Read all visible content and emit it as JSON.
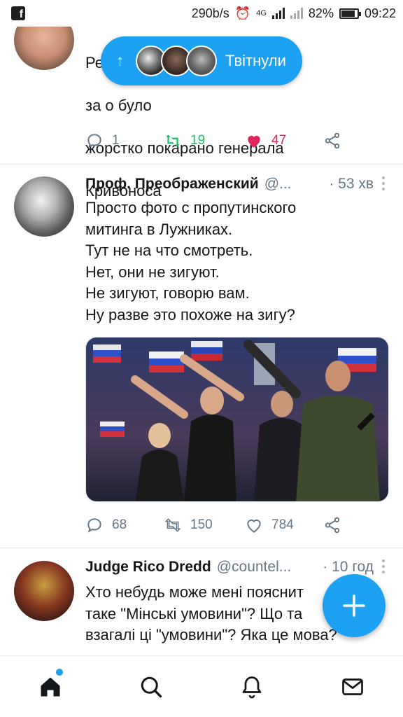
{
  "status_bar": {
    "speed": "290b/s",
    "network": "4G",
    "battery": "82%",
    "time": "09:22"
  },
  "pill": {
    "label": "Твітнули"
  },
  "tweets": [
    {
      "text_top_line": "Резі                          али",
      "text_line2": "за                                   о було",
      "text_line3": "жорстко покарано генерала",
      "text_line4": "Кривоноса",
      "replies": "1",
      "retweets": "19",
      "likes": "47"
    },
    {
      "name": "Проф. Преображенский",
      "handle": "@...",
      "time": "· 53 хв",
      "text": "Просто фото с пропутинского\nмитинга в Лужниках.\nТут не на что смотреть.\nНет, они не зигуют.\nНе зигуют, говорю вам.\nНу разве это похоже на зигу?",
      "replies": "68",
      "retweets": "150",
      "likes": "784"
    },
    {
      "name": "Judge Rico Dredd",
      "handle": "@countel...",
      "time": "· 10 год",
      "text": "Хто небудь може мені пояснит\nтаке \"Мінські умовини\"? Що та\nвзагалі ці \"умовини\"? Яка це мова?"
    }
  ],
  "colors": {
    "accent": "#1da1f2",
    "retweet_green": "#17bf63",
    "like_pink": "#e0245e",
    "muted": "#657786"
  },
  "icons": {
    "home": "home-icon",
    "search": "search-icon",
    "notifications": "bell-icon",
    "messages": "mail-icon",
    "compose": "plus-icon"
  }
}
